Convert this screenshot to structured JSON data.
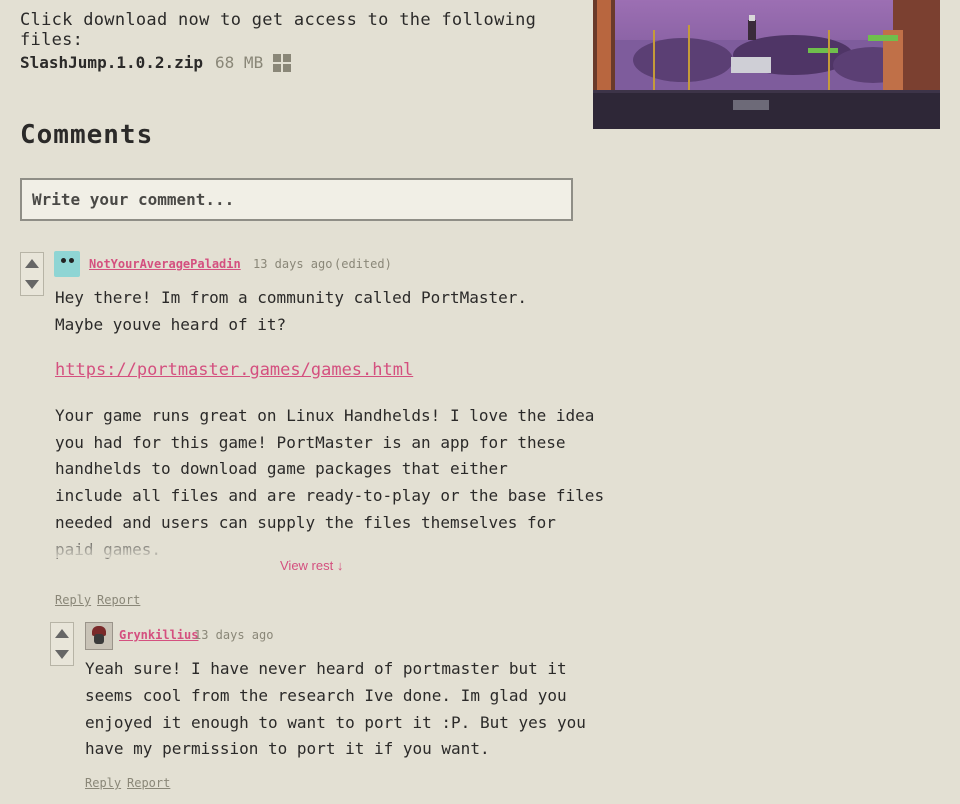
{
  "download": {
    "intro": "Click download now to get access to the following files:",
    "file_name": "SlashJump.1.0.2.zip",
    "file_size": "68 MB",
    "platform_icon": "windows-icon"
  },
  "comments": {
    "title": "Comments",
    "input_placeholder": "Write your comment..."
  },
  "comment1": {
    "author": "NotYourAveragePaladin",
    "time": "13 days ago",
    "edited": "(edited)",
    "line1": "Hey there! Im from a community called PortMaster.",
    "line2": "Maybe youve heard of it?",
    "link": "https://portmaster.games/games.html",
    "p1": "Your game runs great on Linux Handhelds! I love the idea",
    "p2": "you had for this game! PortMaster is an app for these",
    "p3": "handhelds to download game packages that either",
    "p4": "include all files and are ready-to-play or the base files",
    "p5": "needed and users can supply the files themselves for",
    "p6": "paid games.",
    "view_rest": "View rest ↓",
    "reply": "Reply",
    "report": "Report"
  },
  "comment2": {
    "author": "Grynkillius",
    "time": "13 days ago",
    "l1": "Yeah sure! I have never heard of portmaster but it",
    "l2": "seems cool from the research Ive done. Im glad you",
    "l3": "enjoyed it enough to want to port it :P. But yes you",
    "l4": "have my permission to port it if you want.",
    "reply": "Reply",
    "report": "Report"
  },
  "colors": {
    "background": "#e3e0d3",
    "link": "#d4507f",
    "muted": "#8a8778"
  }
}
